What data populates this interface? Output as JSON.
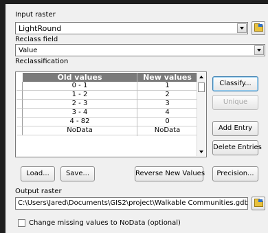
{
  "input_raster": {
    "label": "Input raster",
    "value": "LightRound"
  },
  "reclass_field": {
    "label": "Reclass field",
    "value": "Value"
  },
  "reclassification": {
    "label": "Reclassification",
    "columns": [
      "Old values",
      "New values"
    ],
    "rows": [
      {
        "old": "0 - 1",
        "new": "1"
      },
      {
        "old": "1 - 2",
        "new": "2"
      },
      {
        "old": "2 - 3",
        "new": "3"
      },
      {
        "old": "3 - 4",
        "new": "4"
      },
      {
        "old": "4 - 82",
        "new": "0"
      },
      {
        "old": "NoData",
        "new": "NoData"
      }
    ],
    "buttons": {
      "classify": "Classify...",
      "unique": "Unique",
      "add_entry": "Add Entry",
      "delete_entries": "Delete Entries",
      "load": "Load...",
      "save": "Save...",
      "reverse": "Reverse New Values",
      "precision": "Precision..."
    }
  },
  "output_raster": {
    "label": "Output raster",
    "value": "C:\\Users\\Jared\\Documents\\GIS2\\project\\Walkable Communities.gdb\\LightR"
  },
  "missing_nodata": {
    "label": "Change missing values to NoData (optional)",
    "checked": false
  },
  "icons": {
    "dropdown": "chevron-down-icon",
    "browse": "folder-open-icon",
    "scroll_up": "scroll-up-icon",
    "scroll_down": "scroll-down-icon"
  }
}
